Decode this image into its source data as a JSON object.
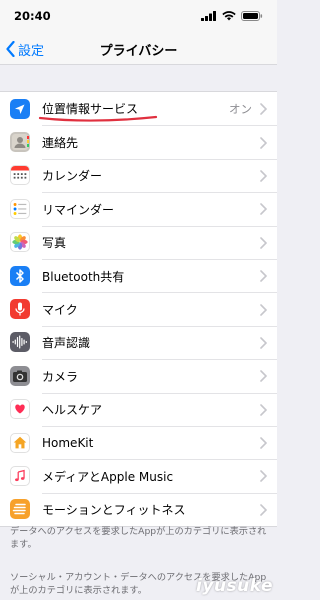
{
  "status_bar": {
    "time": "20:40"
  },
  "nav": {
    "back_label": "設定",
    "title": "プライバシー"
  },
  "rows": [
    {
      "label": "位置情報サービス",
      "value": "オン",
      "icon": "location-arrow-icon",
      "color": "#1a7ff5"
    },
    {
      "label": "連絡先",
      "icon": "contacts-icon",
      "color": "#b9b6b0"
    },
    {
      "label": "カレンダー",
      "icon": "calendar-icon",
      "color": "#ffffff"
    },
    {
      "label": "リマインダー",
      "icon": "reminders-icon",
      "color": "#ffffff"
    },
    {
      "label": "写真",
      "icon": "photos-icon",
      "color": "#ffffff"
    },
    {
      "label": "Bluetooth共有",
      "icon": "bluetooth-icon",
      "color": "#1a7ff5"
    },
    {
      "label": "マイク",
      "icon": "microphone-icon",
      "color": "#f23b30"
    },
    {
      "label": "音声認識",
      "icon": "speech-waveform-icon",
      "color": "#6a6a72"
    },
    {
      "label": "カメラ",
      "icon": "camera-icon",
      "color": "#8e8e93"
    },
    {
      "label": "ヘルスケア",
      "icon": "health-heart-icon",
      "color": "#ffffff"
    },
    {
      "label": "HomeKit",
      "icon": "home-icon",
      "color": "#f5a523"
    },
    {
      "label": "メディアとApple Music",
      "icon": "music-note-icon",
      "color": "#ffffff"
    },
    {
      "label": "モーションとフィットネス",
      "icon": "motion-fitness-icon",
      "color": "#f7a12b"
    }
  ],
  "footer": {
    "note1": "データへのアクセスを要求したAppが上のカテゴリに表示されます。",
    "note2": "ソーシャル・アカウント・データへのアクセスを要求したAppが上のカテゴリに表示されます。"
  },
  "watermark": "iyusuke",
  "accent_color": "#007aff"
}
